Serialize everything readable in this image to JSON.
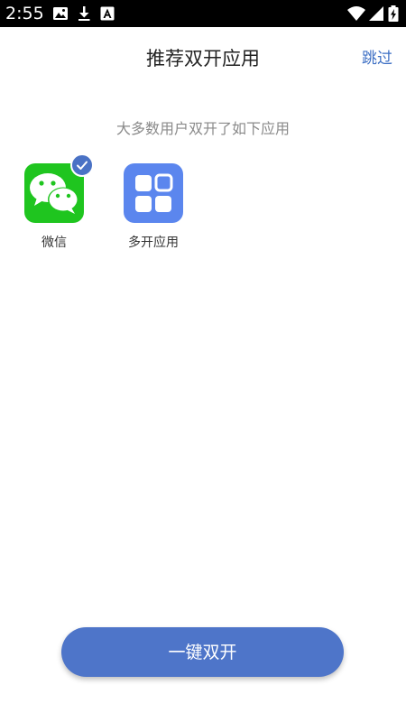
{
  "status_bar": {
    "time": "2:55",
    "icons": [
      "image-icon",
      "download-icon",
      "font-icon",
      "wifi-icon",
      "signal-icon",
      "battery-icon"
    ]
  },
  "header": {
    "title": "推荐双开应用",
    "skip_label": "跳过"
  },
  "subtitle": "大多数用户双开了如下应用",
  "apps": [
    {
      "label": "微信",
      "icon": "wechat-icon",
      "selected": true,
      "color": "#1fc51f"
    },
    {
      "label": "多开应用",
      "icon": "multi-app-icon",
      "selected": false,
      "color": "#5b86ee"
    }
  ],
  "primary_button": {
    "label": "一键双开"
  },
  "colors": {
    "accent": "#4e75c9",
    "link": "#3d6fc4",
    "wechat_green": "#1fc51f"
  }
}
